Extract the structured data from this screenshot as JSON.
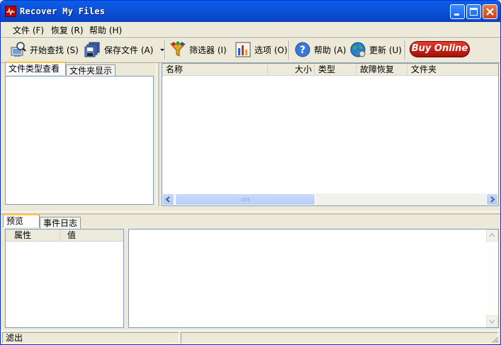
{
  "window": {
    "title": "Recover My Files"
  },
  "menu": [
    {
      "label": "文件 (F)"
    },
    {
      "label": "恢复 (R)"
    },
    {
      "label": "帮助 (H)"
    }
  ],
  "toolbar": {
    "start_search": "开始查找 (S)",
    "save_files": "保存文件 (A)",
    "filter": "筛选器 (I)",
    "options": "选项 (O)",
    "help": "帮助 (A)",
    "update": "更新 (U)",
    "buy_online": "Buy Online"
  },
  "left_tabs": [
    {
      "label": "文件类型查看"
    },
    {
      "label": "文件夹显示"
    }
  ],
  "file_list": {
    "columns": [
      "名称",
      "大小",
      "类型",
      "故障恢复",
      "文件夹"
    ],
    "rows": []
  },
  "bottom_tabs": [
    {
      "label": "预览"
    },
    {
      "label": "事件日志"
    }
  ],
  "properties": {
    "columns": [
      "属性",
      "值"
    ]
  },
  "status": {
    "text": "滤出"
  },
  "colors": {
    "titlebar": "#0A5FE8",
    "face": "#ECE9D8",
    "buy_button": "#C8140C",
    "tab_highlight": "#FFC83C"
  }
}
